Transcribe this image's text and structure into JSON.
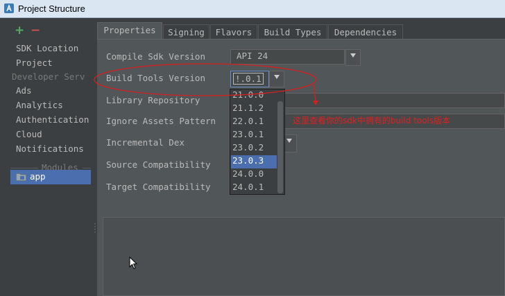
{
  "window": {
    "title": "Project Structure"
  },
  "left_toolbar": {
    "add_label": "+",
    "remove_label": "−"
  },
  "left_list": {
    "items": [
      {
        "label": "SDK Location",
        "type": "item"
      },
      {
        "label": "Project",
        "type": "item"
      },
      {
        "label": "Developer Serv",
        "type": "header"
      },
      {
        "label": "Ads",
        "type": "item"
      },
      {
        "label": "Analytics",
        "type": "item"
      },
      {
        "label": "Authentication",
        "type": "item"
      },
      {
        "label": "Cloud",
        "type": "item"
      },
      {
        "label": "Notifications",
        "type": "item"
      }
    ],
    "modules_header": "Modules",
    "selected_module": "app"
  },
  "tabs": [
    "Properties",
    "Signing",
    "Flavors",
    "Build Types",
    "Dependencies"
  ],
  "active_tab": "Properties",
  "properties": {
    "compile_sdk_label": "Compile Sdk Version",
    "compile_sdk_value": "API 24",
    "build_tools_label": "Build Tools Version",
    "build_tools_value": "!.0.1",
    "library_repo_label": "Library Repository",
    "ignore_assets_label": "Ignore Assets Pattern",
    "incremental_dex_label": "Incremental Dex",
    "source_compat_label": "Source Compatibility",
    "target_compat_label": "Target Compatibility"
  },
  "build_tools_dropdown": {
    "options": [
      "21.0.0",
      "21.1.2",
      "22.0.1",
      "23.0.1",
      "23.0.2",
      "23.0.3",
      "24.0.0",
      "24.0.1"
    ],
    "highlighted": "23.0.3"
  },
  "annotation": {
    "text": "这里查看你的sdk中拥有的build tools版本",
    "color": "#e02020"
  },
  "colors": {
    "accent": "#4b6eaf",
    "background": "#3c3f41",
    "content": "#515658"
  }
}
